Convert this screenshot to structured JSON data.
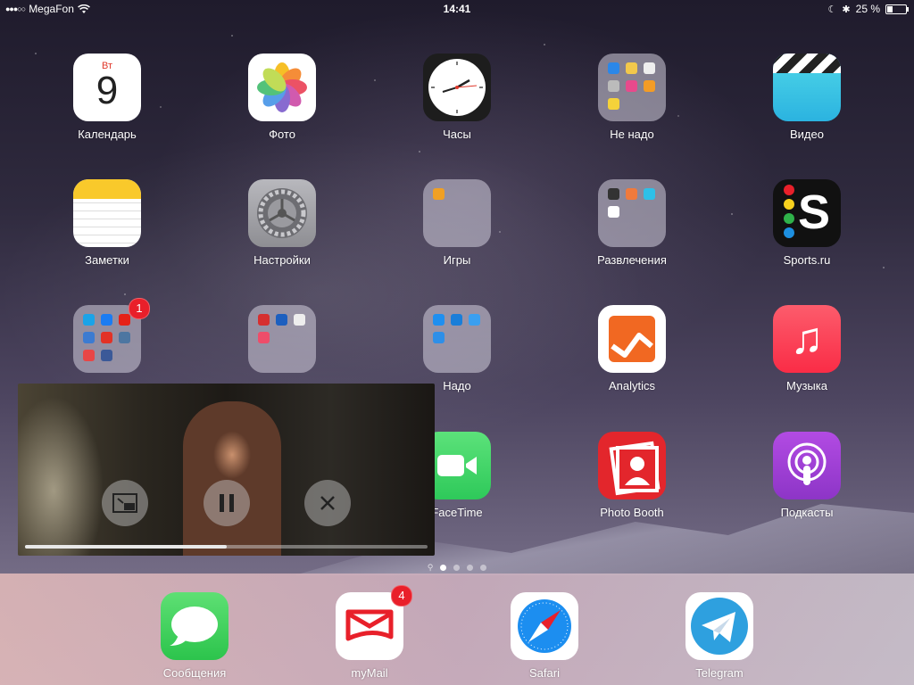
{
  "status_bar": {
    "carrier": "MegaFon",
    "time": "14:41",
    "battery_percent": "25 %",
    "battery_level": 0.25
  },
  "calendar_day_abbr": "Вт",
  "calendar_date": "9",
  "apps": {
    "calendar": "Календарь",
    "photos": "Фото",
    "clock": "Часы",
    "folder_ne_nado": "Не надо",
    "video": "Видео",
    "notes": "Заметки",
    "settings": "Настройки",
    "folder_games": "Игры",
    "folder_entertainment": "Развлечения",
    "sports_ru": "Sports.ru",
    "folder_nado": "Надо",
    "analytics": "Analytics",
    "music": "Музыка",
    "facetime": "FaceTime",
    "photo_booth": "Photo Booth",
    "podcasts": "Подкасты"
  },
  "badges": {
    "social_folder": "1",
    "mymail": "4"
  },
  "pip": {
    "progress": 0.5
  },
  "page_indicator": {
    "pages": 4,
    "active": 1
  },
  "dock": {
    "messages": "Сообщения",
    "mymail": "myMail",
    "safari": "Safari",
    "telegram": "Telegram"
  },
  "colors": {
    "badge": "#e91f2a",
    "music": "#fc3c58",
    "facetime": "#2ec95a",
    "analytics": "#f16822",
    "photo_booth": "#e3262c",
    "podcasts": "#9b3ed1",
    "telegram": "#2ea0df"
  }
}
